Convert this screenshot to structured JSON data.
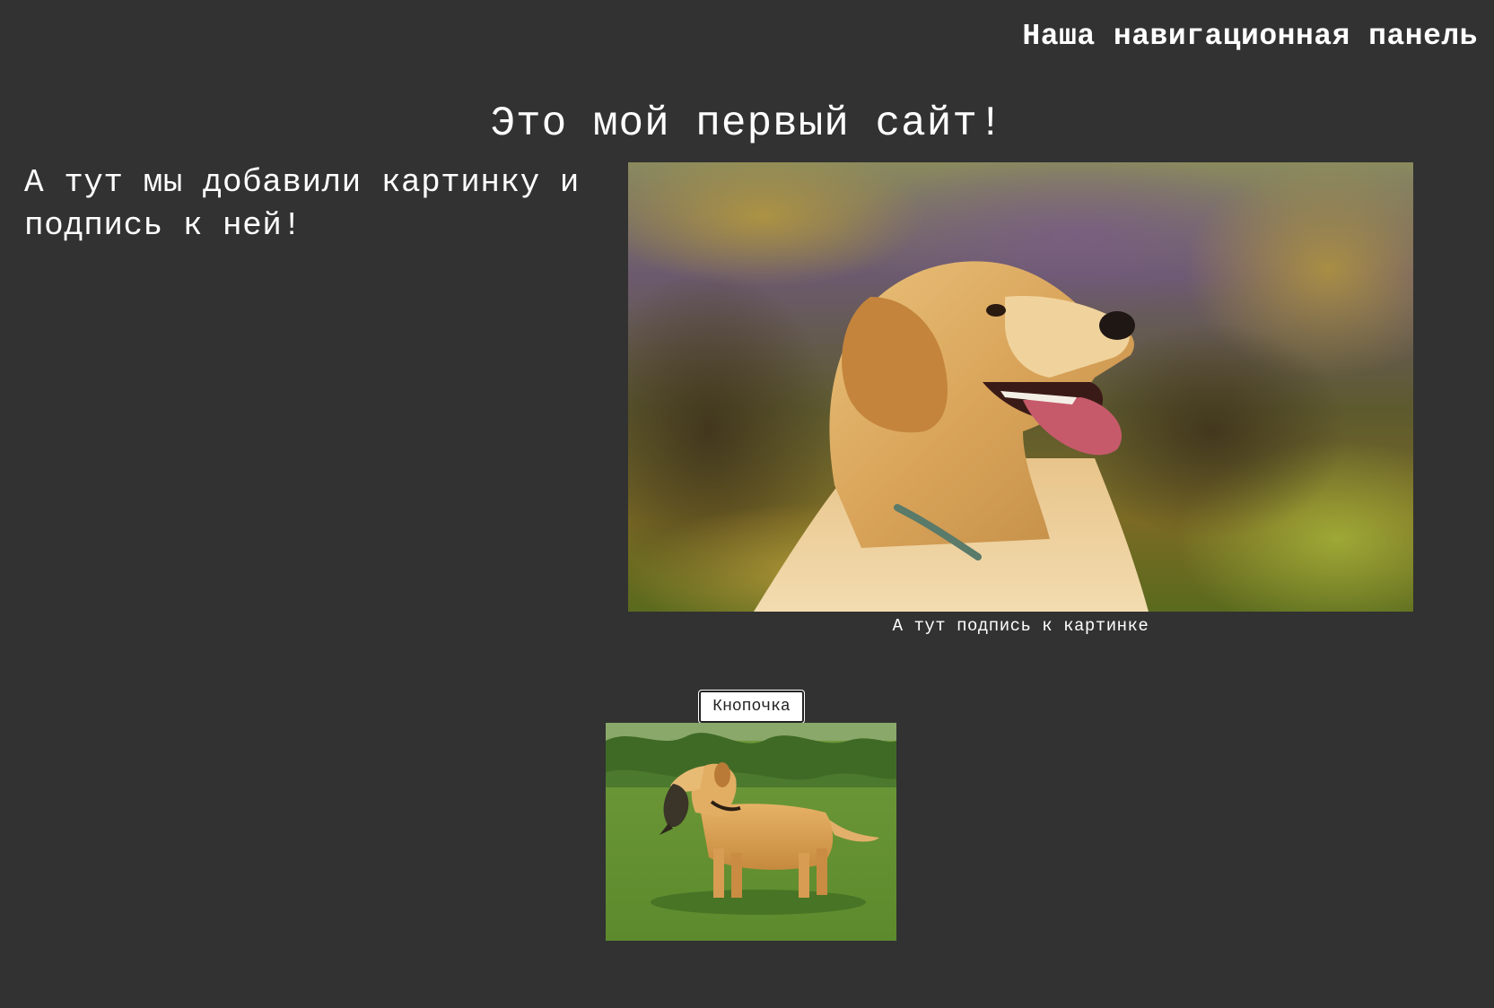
{
  "navbar": {
    "label": "Наша навигационная панель"
  },
  "page": {
    "title": "Это мой первый сайт!",
    "intro": "А тут мы добавили картинку и подпись к ней!"
  },
  "main_figure": {
    "image_icon": "golden-retriever-photo",
    "caption": "А тут подпись к картинке"
  },
  "button": {
    "label": "Кнопочка"
  },
  "second_figure": {
    "image_icon": "labrador-with-bird-photo"
  },
  "colors": {
    "background": "#323232",
    "text": "#ffffff",
    "button_bg": "#ffffff",
    "button_text": "#222222"
  }
}
